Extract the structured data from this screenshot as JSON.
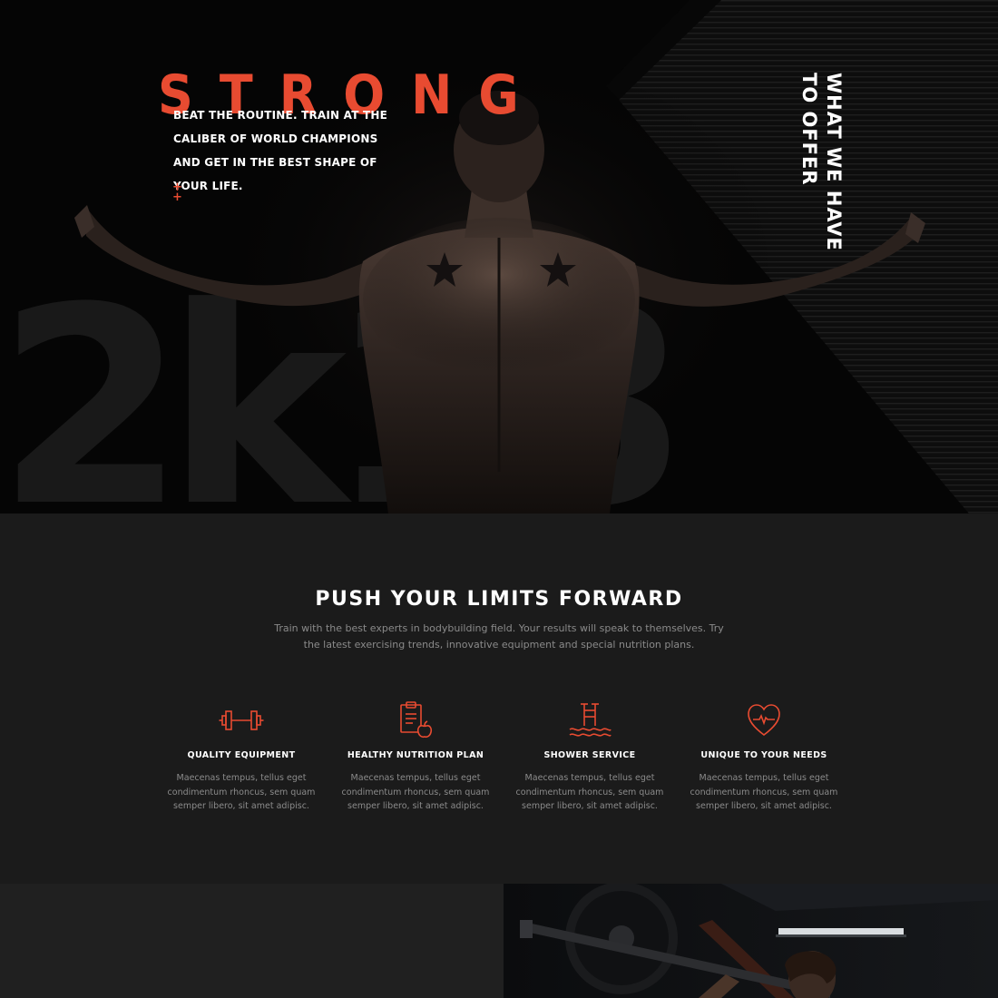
{
  "hero": {
    "brand_title": "STRONG",
    "copy": "BEAT THE ROUTINE. TRAIN AT THE CALIBER OF WORLD CHAMPIONS AND GET IN THE BEST SHAPE OF YOUR LIFE.",
    "plus_marks": "+ +",
    "big_year": "2k18",
    "vertical_title_line1": "WHAT WE HAVE",
    "vertical_title_line2": "TO OFFER",
    "accent_color": "#e84b31"
  },
  "features_section": {
    "title": "PUSH YOUR LIMITS FORWARD",
    "subtitle": "Train with the best experts in bodybuilding field. Your results will speak to themselves. Try the latest exercising trends, innovative equipment and special nutrition plans.",
    "items": [
      {
        "icon": "dumbbell-icon",
        "title": "QUALITY EQUIPMENT",
        "text": "Maecenas tempus, tellus eget condimentum rhoncus, sem quam semper libero, sit amet adipisc."
      },
      {
        "icon": "clipboard-apple-icon",
        "title": "HEALTHY NUTRITION PLAN",
        "text": "Maecenas tempus, tellus eget condimentum rhoncus, sem quam semper libero, sit amet adipisc."
      },
      {
        "icon": "pool-ladder-icon",
        "title": "SHOWER SERVICE",
        "text": "Maecenas tempus, tellus eget condimentum rhoncus, sem quam semper libero, sit amet adipisc."
      },
      {
        "icon": "heart-pulse-icon",
        "title": "UNIQUE TO YOUR NEEDS",
        "text": "Maecenas tempus, tellus eget condimentum rhoncus, sem quam semper libero, sit amet adipisc."
      }
    ]
  }
}
